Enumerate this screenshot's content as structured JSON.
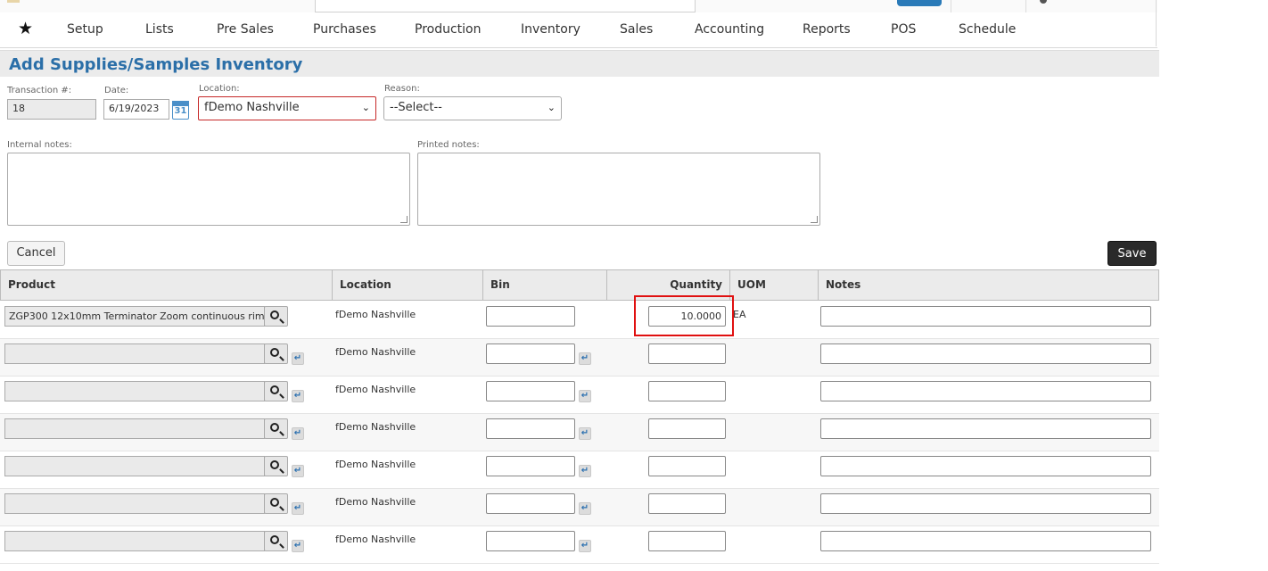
{
  "nav": {
    "favorites_icon": "star-icon",
    "items": [
      "Setup",
      "Lists",
      "Pre Sales",
      "Purchases",
      "Production",
      "Inventory",
      "Sales",
      "Accounting",
      "Reports",
      "POS",
      "Schedule"
    ]
  },
  "page": {
    "title": "Add Supplies/Samples Inventory"
  },
  "form": {
    "transaction_label": "Transaction #:",
    "transaction_value": "18",
    "date_label": "Date:",
    "date_value": "6/19/2023",
    "calendar_icon_text": "31",
    "location_label": "Location:",
    "location_value": "fDemo Nashville",
    "reason_label": "Reason:",
    "reason_value": "--Select--",
    "internal_notes_label": "Internal notes:",
    "printed_notes_label": "Printed notes:"
  },
  "buttons": {
    "cancel": "Cancel",
    "save": "Save"
  },
  "grid": {
    "headers": {
      "product": "Product",
      "location": "Location",
      "bin": "Bin",
      "quantity": "Quantity",
      "uom": "UOM",
      "notes": "Notes"
    },
    "rows": [
      {
        "product": "ZGP300  12x10mm Terminator Zoom continuous rim",
        "location": "fDemo Nashville",
        "quantity": "10.0000",
        "uom": "EA"
      },
      {
        "product": "",
        "location": "fDemo Nashville",
        "quantity": "",
        "uom": ""
      },
      {
        "product": "",
        "location": "fDemo Nashville",
        "quantity": "",
        "uom": ""
      },
      {
        "product": "",
        "location": "fDemo Nashville",
        "quantity": "",
        "uom": ""
      },
      {
        "product": "",
        "location": "fDemo Nashville",
        "quantity": "",
        "uom": ""
      },
      {
        "product": "",
        "location": "fDemo Nashville",
        "quantity": "",
        "uom": ""
      },
      {
        "product": "",
        "location": "fDemo Nashville",
        "quantity": "",
        "uom": ""
      }
    ]
  },
  "colors": {
    "title": "#2b6fa8",
    "highlight": "#e01010",
    "save_button": "#2a2a2a"
  }
}
